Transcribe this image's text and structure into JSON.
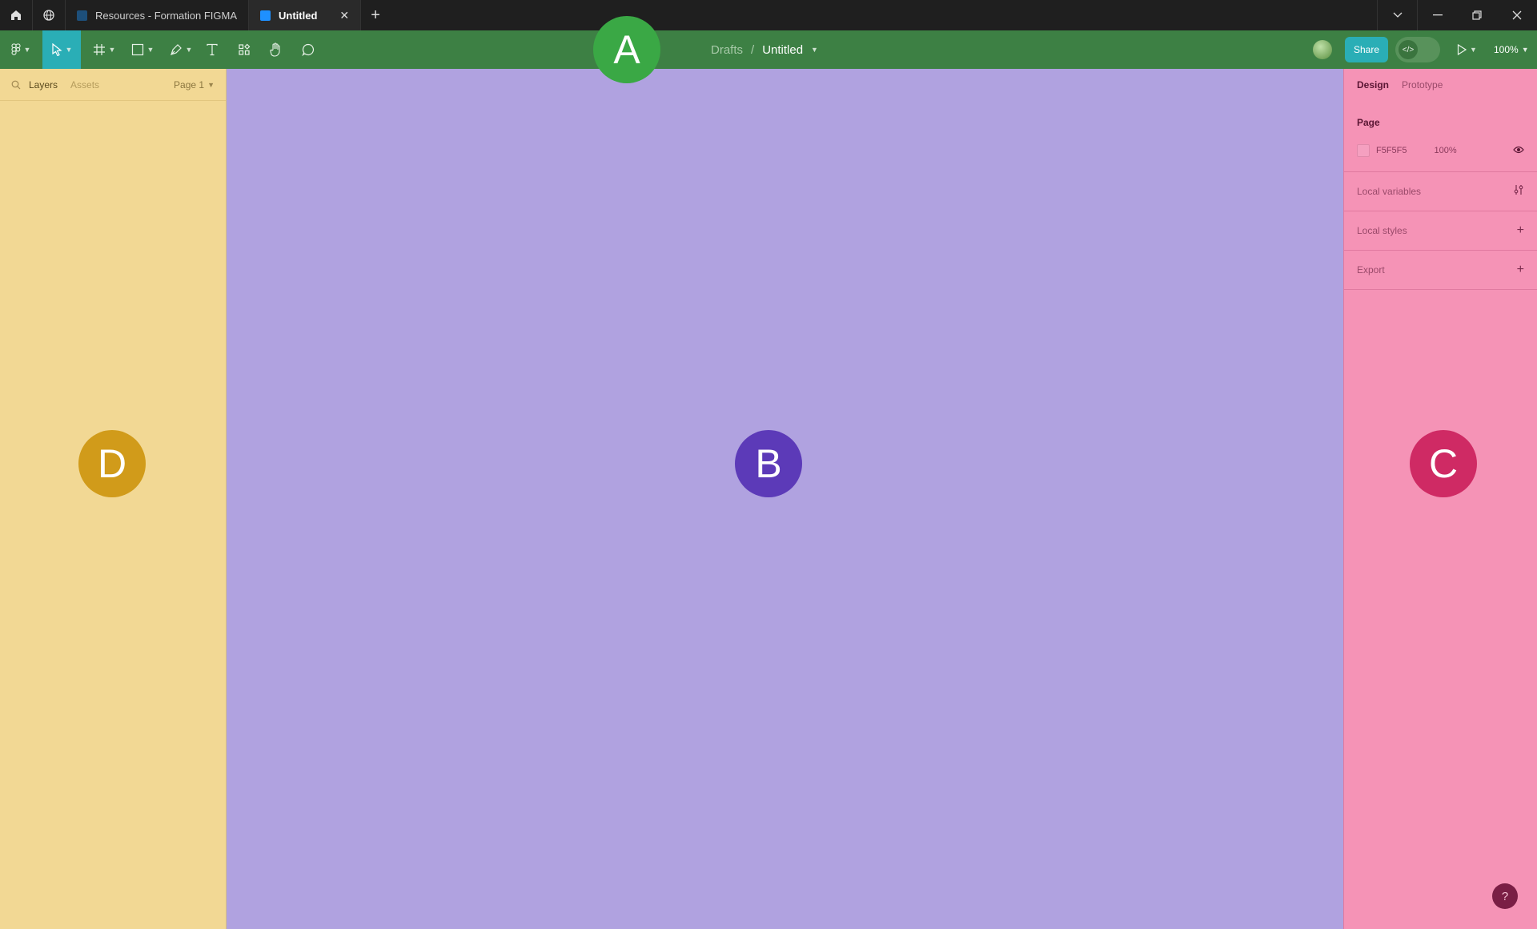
{
  "titlebar": {
    "tabs": [
      {
        "label": "Resources - Formation FIGMA",
        "active": false
      },
      {
        "label": "Untitled",
        "active": true
      }
    ],
    "new_tab": "+"
  },
  "toolbar": {
    "breadcrumb": {
      "project": "Drafts",
      "separator": "/",
      "file": "Untitled"
    },
    "share_label": "Share",
    "zoom": "100%"
  },
  "left_panel": {
    "tabs": {
      "layers": "Layers",
      "assets": "Assets"
    },
    "page_selector": "Page 1"
  },
  "right_panel": {
    "tabs": {
      "design": "Design",
      "prototype": "Prototype"
    },
    "page": {
      "heading": "Page",
      "color": "F5F5F5",
      "opacity": "100%"
    },
    "sections": {
      "local_variables": "Local variables",
      "local_styles": "Local styles",
      "export": "Export"
    }
  },
  "help": "?",
  "markers": {
    "a": "A",
    "b": "B",
    "c": "C",
    "d": "D"
  },
  "colors": {
    "toolbar": "#3d8044",
    "left_panel": "#f2d894",
    "canvas": "#b0a2e0",
    "right_panel": "#f593b6",
    "accent": "#2aaeb6"
  }
}
